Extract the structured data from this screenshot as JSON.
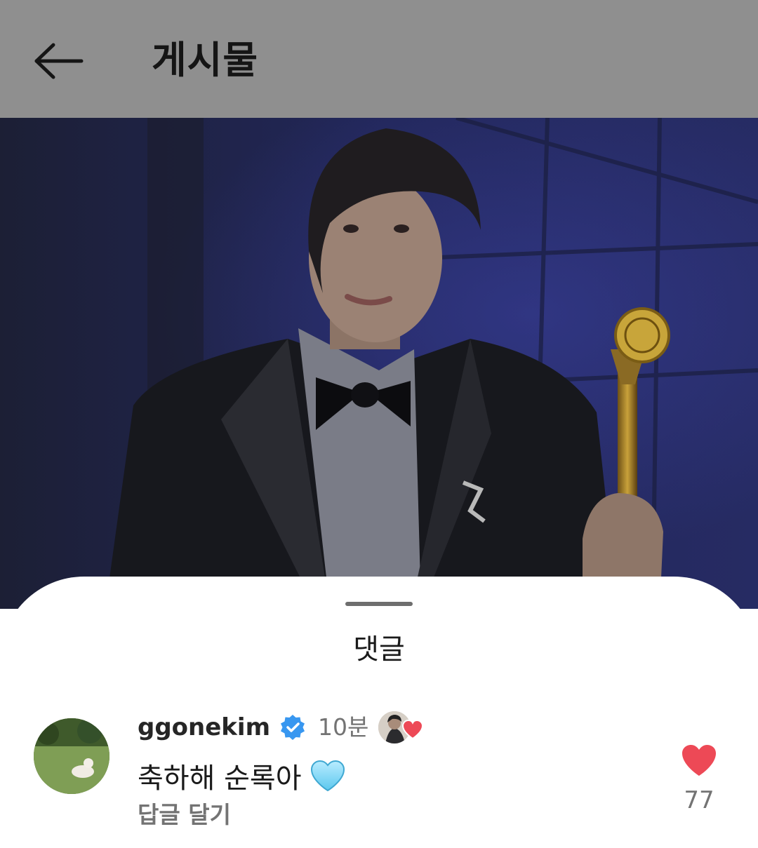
{
  "header": {
    "title": "게시물",
    "back_icon": "arrow-left-icon"
  },
  "post_photo": {
    "description_icon": "photo",
    "background_color": "#1d2140"
  },
  "comments_sheet": {
    "title": "댓글",
    "comment": {
      "username": "ggonekim",
      "verified_icon": "verified-badge-icon",
      "time": "10분",
      "liked_by_author_icon": "heart-icon",
      "text": "축하해 순록아",
      "emoji_icon": "light-blue-heart-icon",
      "reply_label": "답글 달기",
      "like_count": "77",
      "like_icon": "heart-icon",
      "like_color": "#ed4956"
    }
  },
  "colors": {
    "header_dim": "#8f8f8f",
    "verified": "#3897f0",
    "secondary_text": "#737373"
  }
}
